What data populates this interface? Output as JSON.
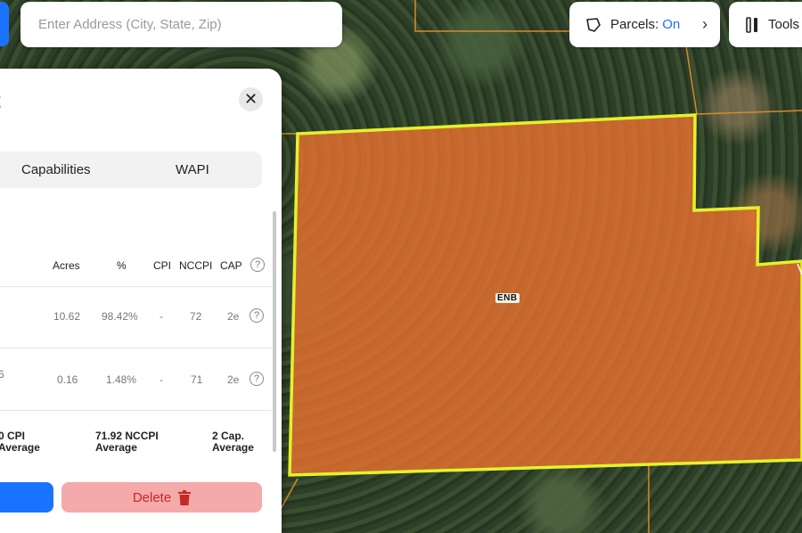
{
  "search": {
    "placeholder": "Enter Address (City, State, Zip)"
  },
  "parcels_control": {
    "label": "Parcels:",
    "state": "On"
  },
  "tools_control": {
    "label": "Tools"
  },
  "map": {
    "soil_unit_label": "ENB",
    "polygon_fill": "#E8722F",
    "polygon_stroke": "#E3F22A",
    "parcel_line_color": "#D98A2B"
  },
  "panel": {
    "title": "t",
    "tabs": [
      "Capabilities",
      "WAPI"
    ],
    "columns": [
      "Acres",
      "%",
      "CPI",
      "NCCPI",
      "CAP"
    ],
    "rows": [
      {
        "name": "",
        "acres": "10.62",
        "percent": "98.42%",
        "cpi": "-",
        "nccpi": "72",
        "cap": "2e"
      },
      {
        "name": "6",
        "acres": "0.16",
        "percent": "1.48%",
        "cpi": "-",
        "nccpi": "71",
        "cap": "2e"
      }
    ],
    "summary": [
      {
        "line1": "0 CPI",
        "line2": "Average"
      },
      {
        "line1": "71.92 NCCPI",
        "line2": "Average"
      },
      {
        "line1": "2 Cap.",
        "line2": "Average"
      }
    ],
    "delete_label": "Delete"
  },
  "icons": {
    "close": "close-icon",
    "help": "help-circle-icon",
    "parcels": "polygon-icon",
    "chevron": "chevron-right-icon",
    "tools": "tools-icon",
    "delete": "trash-icon"
  }
}
